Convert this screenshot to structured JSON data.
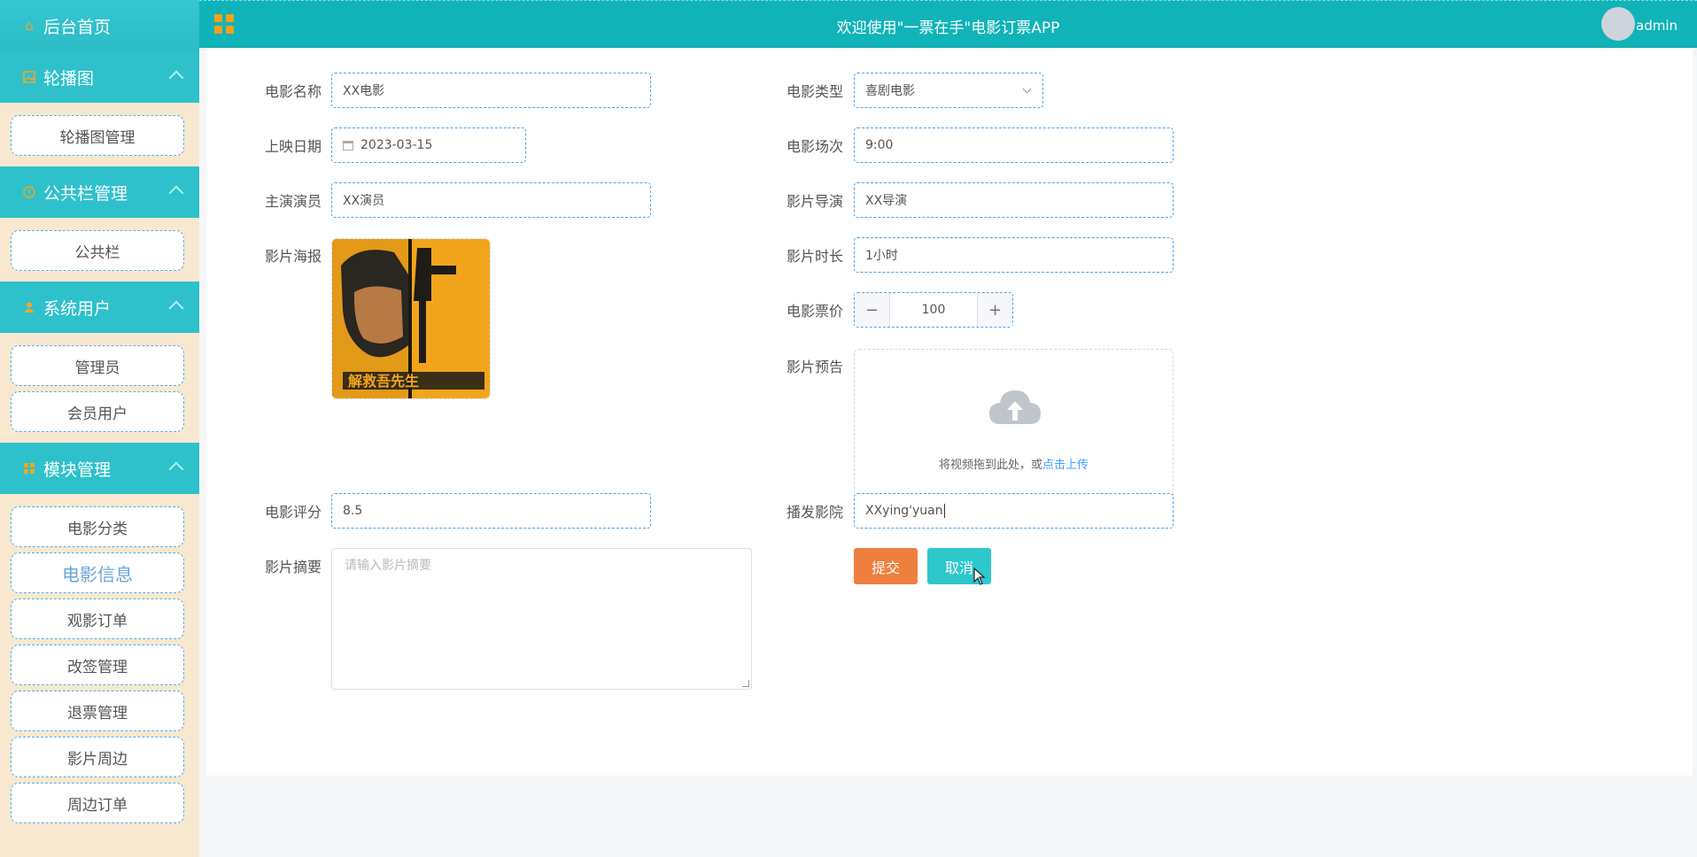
{
  "topbar": {
    "welcome": "欢迎使用\"一票在手\"电影订票APP",
    "username": "admin"
  },
  "sidebar": {
    "home": "后台首页",
    "groups": [
      {
        "title": "轮播图",
        "items": [
          "轮播图管理"
        ]
      },
      {
        "title": "公共栏管理",
        "items": [
          "公共栏"
        ]
      },
      {
        "title": "系统用户",
        "items": [
          "管理员",
          "会员用户"
        ]
      },
      {
        "title": "模块管理",
        "items": [
          "电影分类",
          "电影信息",
          "观影订单",
          "改签管理",
          "退票管理",
          "影片周边",
          "周边订单"
        ]
      }
    ],
    "active_item": "电影信息"
  },
  "form": {
    "labels": {
      "name": "电影名称",
      "release_date": "上映日期",
      "actors": "主演演员",
      "poster": "影片海报",
      "rating": "电影评分",
      "summary": "影片摘要",
      "type": "电影类型",
      "session": "电影场次",
      "director": "影片导演",
      "duration": "影片时长",
      "price": "电影票价",
      "trailer": "影片预告",
      "cinema": "播发影院"
    },
    "values": {
      "name": "XX电影",
      "release_date": "2023-03-15",
      "actors": "XX演员",
      "rating": "8.5",
      "type": "喜剧电影",
      "session": "9:00",
      "director": "XX导演",
      "duration": "1小时",
      "price": "100",
      "cinema": "XXying'yuan"
    },
    "placeholders": {
      "summary": "请输入影片摘要"
    },
    "poster_title": "解救吾先生",
    "upload": {
      "hint": "将视频拖到此处，或",
      "link": "点击上传"
    },
    "buttons": {
      "submit": "提交",
      "cancel": "取消"
    }
  },
  "colors": {
    "sidebar_header": "#2ec1cb",
    "topbar": "#10b3b7",
    "submit": "#ef7f3e",
    "cancel": "#2ec7cc",
    "icon_accent": "#f4a21c"
  }
}
